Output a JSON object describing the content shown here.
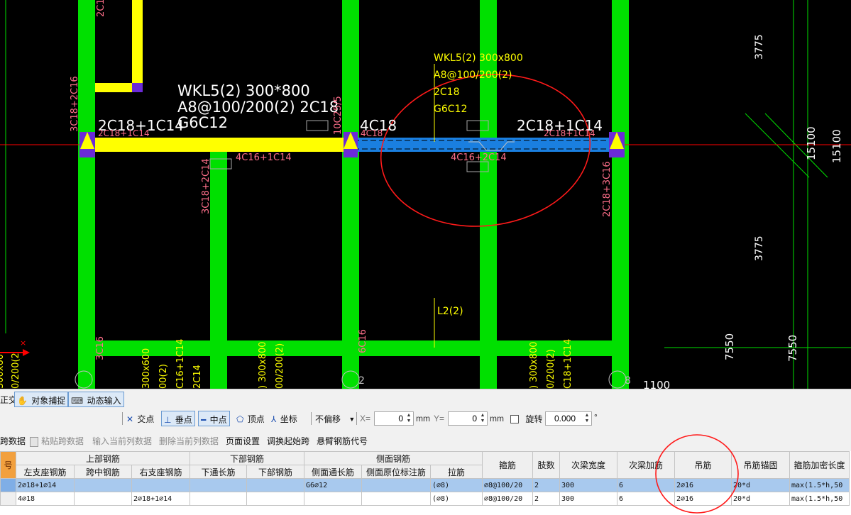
{
  "cad": {
    "beam_main_label": [
      "WKL5(2) 300*800",
      "A8@100/200(2) 2C18",
      "G6C12"
    ],
    "beam_small_label": [
      "WKL5(2) 300x800",
      "A8@100/200(2)",
      "2C18",
      "G6C12"
    ],
    "top_left_support": "2C18+1C14",
    "top_left_support_small": "2C18+1C14",
    "top_mid_support": "4C18",
    "top_mid_support_small": "4C18",
    "top_right_support": "2C18+1C14",
    "top_right_support_small": "2C18+1C14",
    "bottom_left_span": "4C16+1C14",
    "bottom_right_span": "4C16+2C14",
    "secondary_beam_label": "L2(2)",
    "col_left_vert": "3C18+2C16",
    "col_left_lower_vert": "3C18+2C14",
    "col_mid_vert": "10C25/5",
    "col_right_vert": "2C18+3C16",
    "col_top_left_vert": "2C16",
    "bottom_left_3c16": "3C16",
    "bottom_mid_6c16": "6C16",
    "bottom_left_beam_a": "300x600",
    "bottom_left_beam_b": "00(2)",
    "bottom_left_beam_c": "C16+1C14",
    "bottom_left_beam_d": "2C14",
    "bottom_mid_beam_a": ") 300x800",
    "bottom_mid_beam_b": "00/200(2)",
    "bottom_right_beam_a": ") 300x800",
    "bottom_right_beam_b": "0/200(2)",
    "bottom_right_beam_c": "C18+1C14",
    "far_left_a": "300x60",
    "far_left_b": "0/200(2",
    "axis_marker": "2",
    "axis_marker_right": "8",
    "dim_top": "3775",
    "dim_mid": "3775",
    "dim_15100_a": "15100",
    "dim_15100_b": "15100",
    "dim_7550_a": "7550",
    "dim_7550_b": "7550",
    "dim_1100": "1100"
  },
  "snapbar": {
    "left_fragment": "正交",
    "object_snap": "对象捕捉",
    "dynamic_input": "动态输入"
  },
  "pointbar": {
    "intersection": "交点",
    "perpendicular": "垂点",
    "midpoint": "中点",
    "vertex": "顶点",
    "coordinate": "坐标",
    "offset_mode": "不偏移",
    "x_label": "X=",
    "x_value": "0",
    "y_label": "Y=",
    "y_value": "0",
    "unit": "mm",
    "rotate_label": "旋转",
    "rotate_value": "0.000",
    "degree": "°"
  },
  "actionbar": {
    "copy_span": "跨数据",
    "paste_span": "粘贴跨数据",
    "input_col": "输入当前列数据",
    "delete_col": "删除当前列数据",
    "page_setup": "页面设置",
    "swap_start": "调换起始跨",
    "cantilever_code": "悬臂钢筋代号"
  },
  "grid": {
    "index_header": "号",
    "group_top": "上部钢筋",
    "group_bottom": "下部钢筋",
    "group_side": "侧面钢筋",
    "cols": {
      "left_support": "左支座钢筋",
      "mid_span": "跨中钢筋",
      "right_support": "右支座钢筋",
      "bottom_through": "下通长筋",
      "bottom_bar": "下部钢筋",
      "side_through": "侧面通长筋",
      "side_original": "侧面原位标注筋",
      "tie": "拉筋",
      "stirrup": "箍筋",
      "legs": "肢数",
      "sec_width": "次梁宽度",
      "sec_add": "次梁加筋",
      "hanger": "吊筋",
      "hanger_anchor": "吊筋锚固",
      "stirrup_dense": "箍筋加密长度"
    },
    "rows": [
      {
        "left_support": "2⌀18+1⌀14",
        "mid_span": "",
        "right_support": "",
        "bottom_through": "",
        "bottom_bar": "",
        "side_through": "G6⌀12",
        "side_original": "",
        "tie": "(⌀8)",
        "stirrup": "⌀8@100/20",
        "legs": "2",
        "sec_width": "300",
        "sec_add": "6",
        "hanger": "2⌀16",
        "hanger_anchor": "20*d",
        "stirrup_dense": "max(1.5*h,50"
      },
      {
        "left_support": "4⌀18",
        "mid_span": "",
        "right_support": "2⌀18+1⌀14",
        "bottom_through": "",
        "bottom_bar": "",
        "side_through": "",
        "side_original": "",
        "tie": "(⌀8)",
        "stirrup": "⌀8@100/20",
        "legs": "2",
        "sec_width": "300",
        "sec_add": "6",
        "hanger": "2⌀16",
        "hanger_anchor": "20*d",
        "stirrup_dense": "max(1.5*h,50"
      }
    ]
  },
  "colors": {
    "canvas_bg": "#000000",
    "column_green": "#00e000",
    "beam_yellow": "#ffff00",
    "beam_blue": "#1a7fe0",
    "annotation_red": "#ff0000",
    "rebar_pink": "#ff6f8a",
    "selected_row": "#a8c9ee",
    "index_orange": "#f2a03e"
  }
}
